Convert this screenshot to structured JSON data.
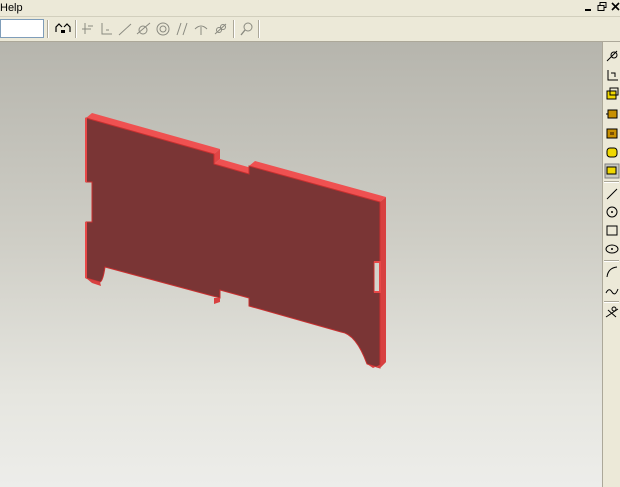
{
  "menubar": {
    "help_label": "Help"
  },
  "colors": {
    "part_face": "#7a3535",
    "part_edge": "#ee4a4a",
    "part_outline": "#c83030",
    "background_top": "#b6b5ad",
    "background_bottom": "#ededea"
  },
  "toolbar": {
    "icons": [
      "constraint-icon",
      "axis-icon",
      "angle-icon",
      "line-icon",
      "tangent-icon",
      "concentric-icon",
      "parallel-icon",
      "perpendicular-icon",
      "coincident-icon",
      "measure-icon"
    ]
  },
  "right_toolbar": {
    "icons": [
      "sketch-icon",
      "sketch-plane-icon",
      "extrude-icon",
      "revolve-icon",
      "pocket-icon",
      "fillet-icon",
      "pattern-icon",
      "line-icon",
      "circle-icon",
      "rectangle-icon",
      "ellipse-icon",
      "arc-icon",
      "spline-icon",
      "trim-icon"
    ]
  }
}
